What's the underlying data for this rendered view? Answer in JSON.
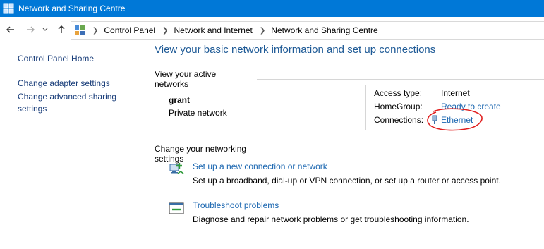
{
  "window": {
    "title": "Network and Sharing Centre",
    "accent_color": "#0078d7"
  },
  "navigation": {
    "back_icon": "back-arrow-icon",
    "forward_icon": "forward-arrow-icon",
    "recent_icon": "chevron-down-icon",
    "up_icon": "up-arrow-icon"
  },
  "breadcrumb": [
    "Control Panel",
    "Network and Internet",
    "Network and Sharing Centre"
  ],
  "sidebar": {
    "items": [
      {
        "label": "Control Panel Home"
      },
      {
        "label": "Change adapter settings"
      },
      {
        "label": "Change advanced sharing settings"
      }
    ]
  },
  "main": {
    "title": "View your basic network information and set up connections",
    "active_networks": {
      "heading": "View your active networks",
      "network_name": "grant",
      "network_type": "Private network",
      "access_type_label": "Access type:",
      "access_type_value": "Internet",
      "homegroup_label": "HomeGroup:",
      "homegroup_value": "Ready to create",
      "connections_label": "Connections:",
      "connections_value": "Ethernet",
      "annotation_color": "#e01e1e"
    },
    "change_settings": {
      "heading": "Change your networking settings",
      "tasks": [
        {
          "label": "Set up a new connection or network",
          "description": "Set up a broadband, dial-up or VPN connection, or set up a router or access point.",
          "icon": "new-connection-icon"
        },
        {
          "label": "Troubleshoot problems",
          "description": "Diagnose and repair network problems or get troubleshooting information.",
          "icon": "troubleshoot-icon"
        }
      ]
    }
  }
}
